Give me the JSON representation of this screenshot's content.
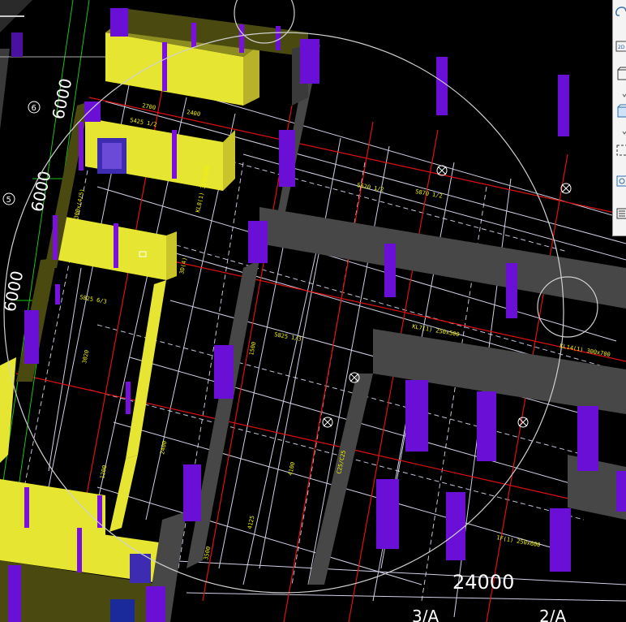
{
  "viewport": {
    "axis_labels": {
      "left_dims": [
        "6000",
        "6000",
        "6000"
      ],
      "left_bubbles": [
        "6",
        "5"
      ],
      "bottom_bubbles": [
        "3/A",
        "2/A"
      ],
      "bottom_dim": "24000"
    },
    "annotations": [
      "5425 1/2",
      "2700",
      "2400",
      "5620 1/2",
      "5870 1/2",
      "KL8(1) 300x600",
      "3D(4)",
      "300x(4/5)",
      "5825 6/3",
      "3020",
      "1500",
      "1200",
      "2400",
      "KL14(1) 300x700",
      "5825 1/3",
      "KL7(1) 250x500",
      "C25/C25",
      "4125",
      "1F(1) 250x600",
      "4100",
      "3500"
    ]
  },
  "toolbar": {
    "buttons": [
      {
        "name": "orbit-view-icon"
      },
      {
        "name": "2d-view-icon",
        "label": "2D"
      },
      {
        "name": "box-view-icon"
      },
      {
        "name": "box-solid-view-icon"
      },
      {
        "name": "select-window-icon"
      },
      {
        "name": "zoom-extents-icon"
      },
      {
        "name": "properties-list-icon"
      }
    ]
  },
  "colors": {
    "background": "#000000",
    "grid_red": "#e01010",
    "grid_white": "#e6e6ff",
    "beam_gray": "#474747",
    "column_purple": "#6a10d6",
    "wall_yellow": "#e6e632",
    "wall_olive": "#4a4a10",
    "text_yellow": "#f2f200"
  }
}
